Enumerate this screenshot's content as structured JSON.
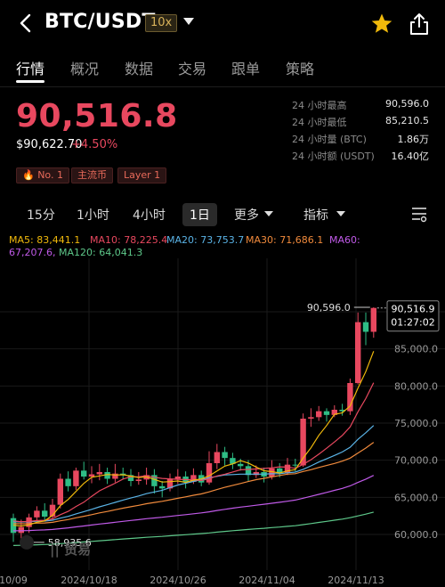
{
  "header": {
    "pair": "BTC/USDT",
    "leverage": "10x"
  },
  "tabs": [
    "行情",
    "概况",
    "数据",
    "交易",
    "跟单",
    "策略"
  ],
  "price": {
    "last": "90,516.8",
    "usd": "$90,622.70",
    "change": "+4.50%"
  },
  "tags": [
    "No. 1",
    "主流币",
    "Layer 1"
  ],
  "stats": [
    {
      "label": "24 小时最高",
      "value": "90,596.0"
    },
    {
      "label": "24 小时最低",
      "value": "85,210.5"
    },
    {
      "label": "24 小时量 (BTC)",
      "value": "1.86万"
    },
    {
      "label": "24 小时额 (USDT)",
      "value": "16.40亿"
    }
  ],
  "intervals": {
    "i15m": "15分",
    "i1h": "1小时",
    "i4h": "4小时",
    "i1d": "1日",
    "more": "更多",
    "indicator": "指标"
  },
  "ma": {
    "ma5": "MA5: 83,441.1",
    "ma10": "MA10: 78,225.4",
    "ma20": "MA20: 73,753.7",
    "ma30": "MA30: 71,686.1",
    "ma60": "MA60: 67,207.6",
    "ma120": "MA120: 64,041.3"
  },
  "colors": {
    "up": "#e8485f",
    "down": "#2ebd85",
    "ma5": "#f0b90b",
    "ma10": "#e8485f",
    "ma20": "#5ab3e6",
    "ma30": "#f08a3c",
    "ma60": "#c05ae8",
    "ma120": "#5ec88a"
  },
  "chart_data": {
    "type": "candlestick",
    "y_ticks": [
      "90,000.0",
      "85,000.0",
      "80,000.0",
      "75,000.0",
      "70,000.0",
      "65,000.0",
      "60,000.0"
    ],
    "x_ticks": [
      "10/09",
      "2024/10/18",
      "2024/10/26",
      "2024/11/04",
      "2024/11/13"
    ],
    "high_label": "90,596.0",
    "low_label": "58,935.6",
    "last_label": "90,516.9",
    "countdown": "01:27:02",
    "ylim": [
      58000,
      92000
    ],
    "candles": [
      [
        62200,
        60200,
        62800,
        59000
      ],
      [
        60200,
        61000,
        62000,
        58935.6
      ],
      [
        61000,
        62300,
        62800,
        60200
      ],
      [
        62300,
        63200,
        63800,
        61800
      ],
      [
        63200,
        62400,
        64200,
        61900
      ],
      [
        62400,
        64000,
        64800,
        62000
      ],
      [
        64000,
        67500,
        68200,
        63500
      ],
      [
        67500,
        66500,
        68500,
        65800
      ],
      [
        66500,
        68600,
        69000,
        66000
      ],
      [
        68600,
        67800,
        69800,
        67400
      ],
      [
        67800,
        68100,
        69200,
        66900
      ],
      [
        68100,
        68400,
        69500,
        67300
      ],
      [
        68400,
        67500,
        69000,
        66800
      ],
      [
        67500,
        68200,
        69500,
        67000
      ],
      [
        68200,
        68000,
        69000,
        67400
      ],
      [
        68000,
        67200,
        68800,
        66500
      ],
      [
        67200,
        67400,
        68400,
        66700
      ],
      [
        67400,
        68000,
        69000,
        66700
      ],
      [
        68000,
        66500,
        68800,
        65500
      ],
      [
        66500,
        66200,
        67200,
        65000
      ],
      [
        66200,
        67500,
        68200,
        65800
      ],
      [
        67500,
        67800,
        68800,
        66800
      ],
      [
        67800,
        67100,
        68500,
        66200
      ],
      [
        67100,
        68000,
        68900,
        66800
      ],
      [
        68000,
        67000,
        68600,
        66500
      ],
      [
        67000,
        69600,
        71200,
        66700
      ],
      [
        69600,
        71100,
        72200,
        68800
      ],
      [
        71100,
        70300,
        71800,
        69300
      ],
      [
        70300,
        69500,
        71000,
        68800
      ],
      [
        69500,
        69200,
        70200,
        68600
      ],
      [
        69200,
        68000,
        70000,
        67200
      ],
      [
        68000,
        68400,
        69300,
        67600
      ],
      [
        68400,
        67800,
        69000,
        67000
      ],
      [
        67800,
        68900,
        70000,
        67400
      ],
      [
        68900,
        68300,
        69600,
        67700
      ],
      [
        68300,
        69400,
        70300,
        68000
      ],
      [
        69400,
        69300,
        70200,
        68500
      ],
      [
        69300,
        75600,
        76300,
        69100
      ],
      [
        75600,
        75800,
        77000,
        74500
      ],
      [
        75800,
        76600,
        77300,
        75300
      ],
      [
        76600,
        76100,
        77000,
        75200
      ],
      [
        76100,
        76800,
        77400,
        75800
      ],
      [
        76800,
        76600,
        77600,
        76000
      ],
      [
        76600,
        80400,
        81000,
        76100
      ],
      [
        80400,
        88600,
        89900,
        80200
      ],
      [
        88600,
        87300,
        89900,
        85500
      ],
      [
        87300,
        90516.9,
        90596,
        86500
      ]
    ]
  }
}
